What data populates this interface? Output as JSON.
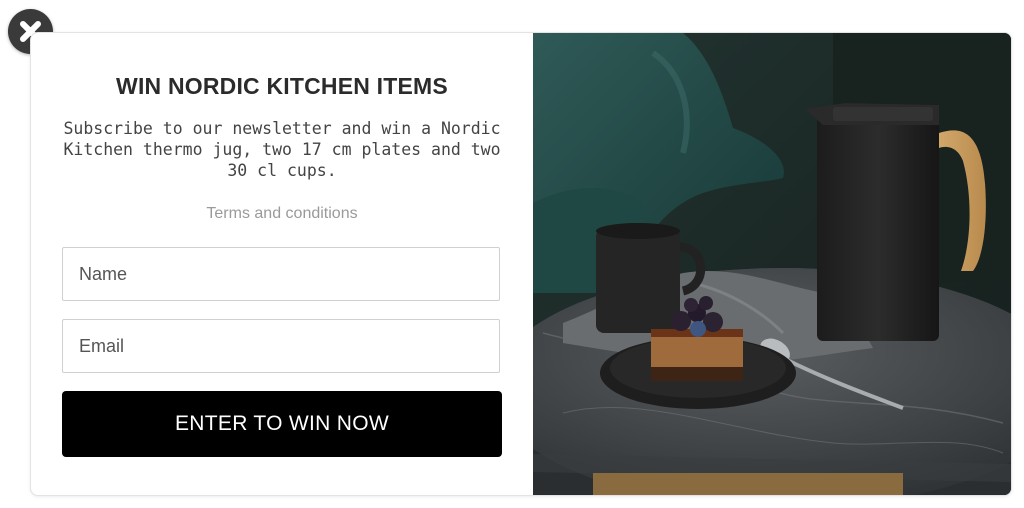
{
  "popup": {
    "title": "WIN NORDIC KITCHEN ITEMS",
    "description": "Subscribe to our newsletter and win a Nordic Kitchen thermo jug, two 17 cm plates and two 30 cl cups.",
    "terms_link": "Terms and conditions",
    "name_placeholder": "Name",
    "email_placeholder": "Email",
    "submit_label": "ENTER TO WIN NOW",
    "close_icon": "close-icon"
  }
}
